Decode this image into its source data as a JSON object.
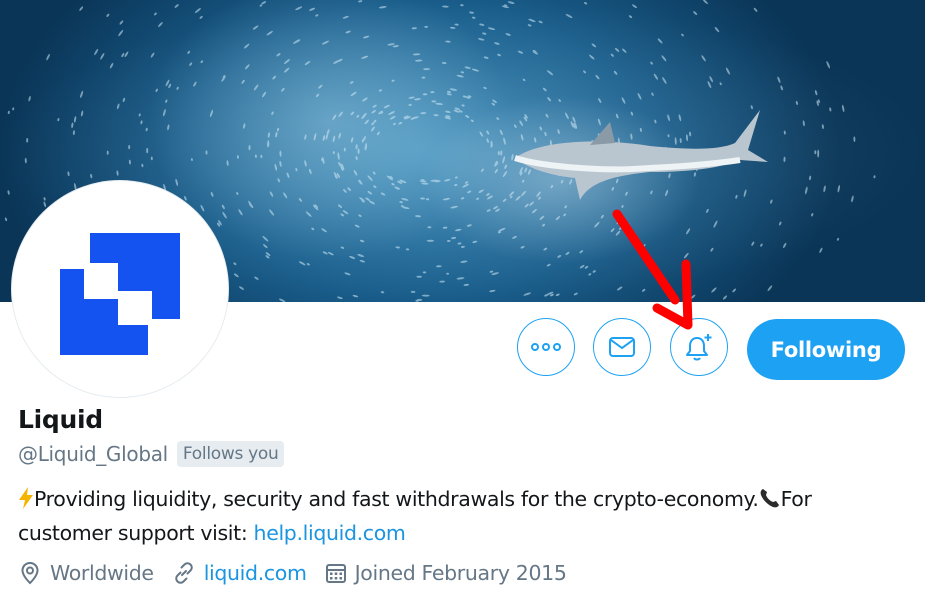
{
  "banner": {
    "image_name": "shark-swimming-through-fish-school"
  },
  "avatar": {
    "logo_name": "liquid-logo",
    "color": "#1553f0"
  },
  "actions": {
    "more_icon": "more-dots-icon",
    "message_icon": "envelope-icon",
    "notify_icon": "bell-plus-icon",
    "following_label": "Following",
    "accent_color": "#1da1f2"
  },
  "annotation": {
    "icon": "red-arrow-icon",
    "color": "#ff0000"
  },
  "profile": {
    "display_name": "Liquid",
    "handle": "@Liquid_Global",
    "follows_you": "Follows you",
    "bio": {
      "lead_emoji": "⚡",
      "text_1": "Providing liquidity, security and fast withdrawals for the crypto-economy.",
      "phone_emoji": "📞",
      "text_2": "For customer support visit: ",
      "link": "help.liquid.com"
    },
    "location": "Worldwide",
    "website": "liquid.com",
    "joined": "Joined February 2015"
  }
}
